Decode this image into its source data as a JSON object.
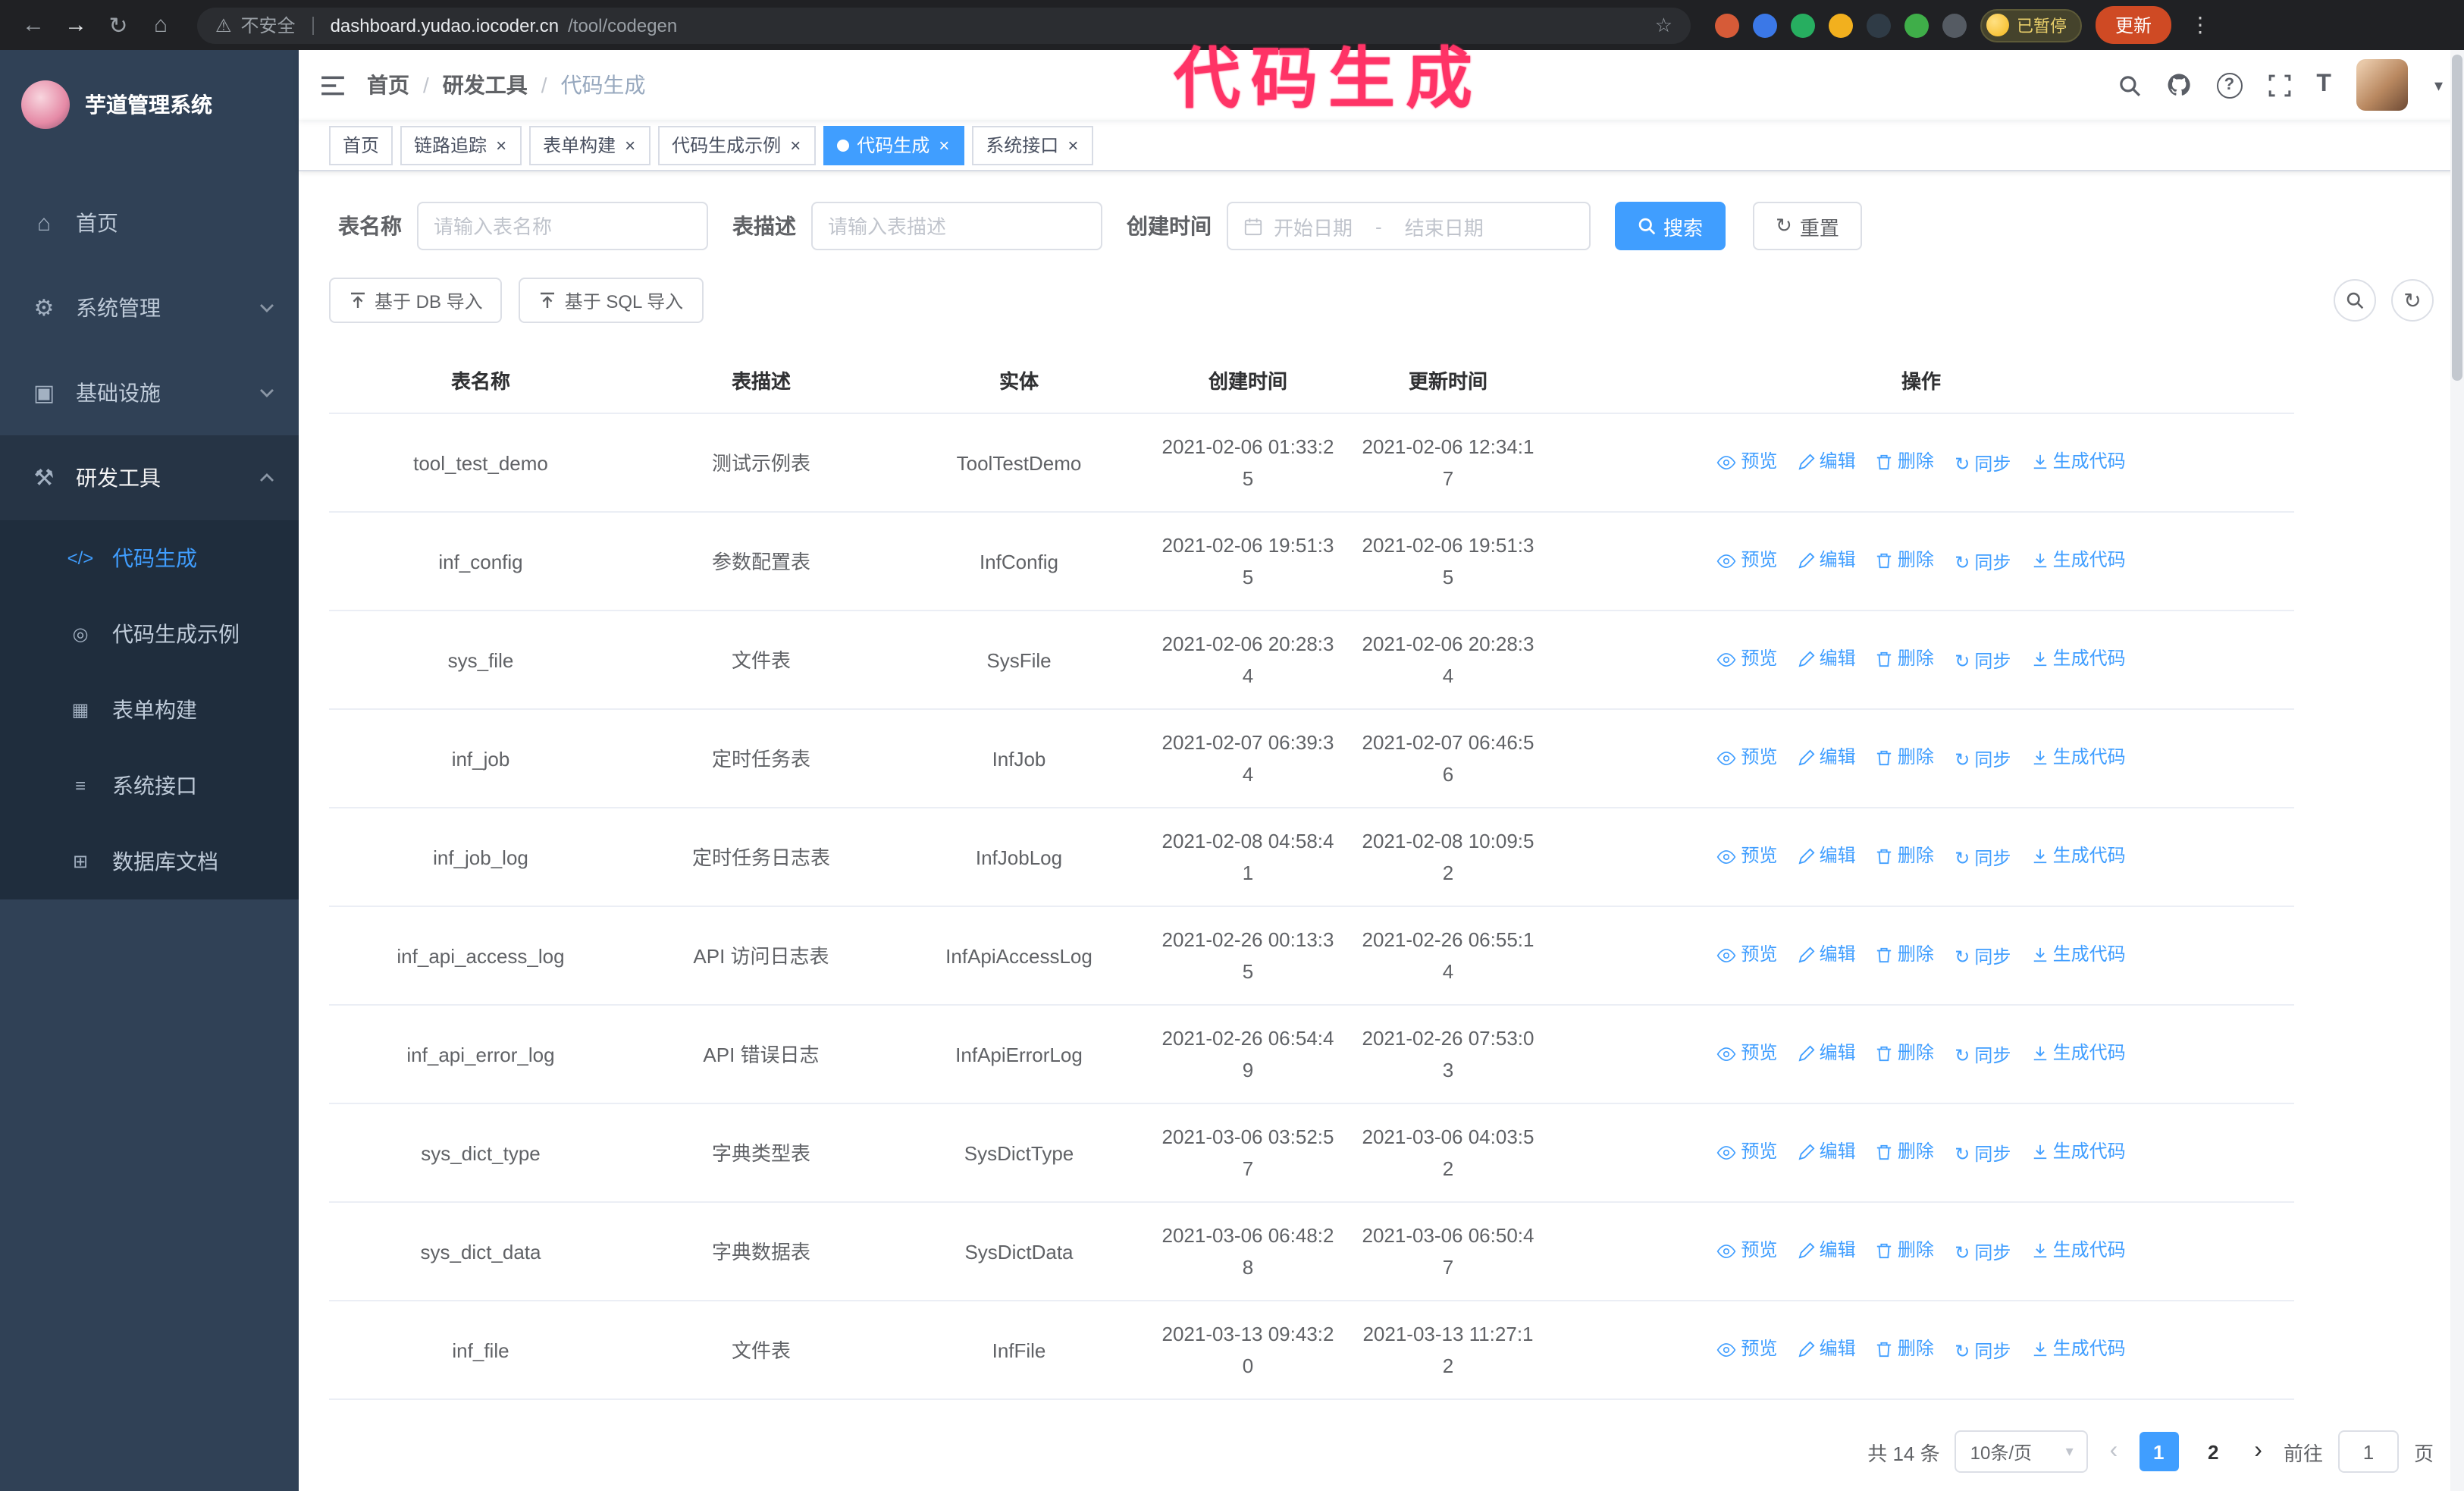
{
  "annotation": {
    "text": "代码生成"
  },
  "colors": {
    "primary": "#409eff",
    "sidebar": "#304156",
    "submenu": "#1f2d3d",
    "annotation": "#ff3366",
    "update_button": "#cf4a24"
  },
  "browser": {
    "security_label": "不安全",
    "url_domain": "dashboard.yudao.iocoder.cn",
    "url_path": "/tool/codegen",
    "paused_badge": "已暂停",
    "update_button": "更新"
  },
  "icons": {
    "back": "←",
    "forward": "→",
    "reload": "↻",
    "home": "⌂",
    "warning": "⚠",
    "star": "☆",
    "kebab": "⋮",
    "close": "×",
    "caret_down": "▾",
    "chevron_prev": "‹",
    "chevron_next": "›",
    "question": "?",
    "font_size": "T",
    "refresh": "↻",
    "sync": "↻",
    "menu_home": "⌂",
    "menu_system": "⚙",
    "menu_infra": "▣",
    "menu_devtools": "⚒",
    "submenu_codegen": "</>",
    "submenu_example": "◎",
    "submenu_form": "▦",
    "submenu_api": "≡",
    "submenu_dbdoc": "⊞"
  },
  "sidebar": {
    "app_title": "芋道管理系统",
    "items": [
      {
        "label": "首页"
      },
      {
        "label": "系统管理"
      },
      {
        "label": "基础设施"
      },
      {
        "label": "研发工具"
      }
    ],
    "submenu": [
      {
        "label": "代码生成"
      },
      {
        "label": "代码生成示例"
      },
      {
        "label": "表单构建"
      },
      {
        "label": "系统接口"
      },
      {
        "label": "数据库文档"
      }
    ]
  },
  "breadcrumb": [
    "首页",
    "研发工具",
    "代码生成"
  ],
  "tabs": [
    {
      "label": "首页"
    },
    {
      "label": "链路追踪"
    },
    {
      "label": "表单构建"
    },
    {
      "label": "代码生成示例"
    },
    {
      "label": "代码生成"
    },
    {
      "label": "系统接口"
    }
  ],
  "filters": {
    "table_name_label": "表名称",
    "table_name_placeholder": "请输入表名称",
    "table_desc_label": "表描述",
    "table_desc_placeholder": "请输入表描述",
    "create_time_label": "创建时间",
    "date_start_placeholder": "开始日期",
    "date_separator": "-",
    "date_end_placeholder": "结束日期",
    "search_button": "搜索",
    "reset_button": "重置"
  },
  "toolbar": {
    "import_db_button": "基于 DB 导入",
    "import_sql_button": "基于 SQL 导入"
  },
  "table": {
    "columns": [
      "表名称",
      "表描述",
      "实体",
      "创建时间",
      "更新时间",
      "操作"
    ],
    "actions": [
      "预览",
      "编辑",
      "删除",
      "同步",
      "生成代码"
    ],
    "rows": [
      {
        "name": "tool_test_demo",
        "desc": "测试示例表",
        "entity": "ToolTestDemo",
        "created": "2021-02-06 01:33:25",
        "updated": "2021-02-06 12:34:17"
      },
      {
        "name": "inf_config",
        "desc": "参数配置表",
        "entity": "InfConfig",
        "created": "2021-02-06 19:51:35",
        "updated": "2021-02-06 19:51:35"
      },
      {
        "name": "sys_file",
        "desc": "文件表",
        "entity": "SysFile",
        "created": "2021-02-06 20:28:34",
        "updated": "2021-02-06 20:28:34"
      },
      {
        "name": "inf_job",
        "desc": "定时任务表",
        "entity": "InfJob",
        "created": "2021-02-07 06:39:34",
        "updated": "2021-02-07 06:46:56"
      },
      {
        "name": "inf_job_log",
        "desc": "定时任务日志表",
        "entity": "InfJobLog",
        "created": "2021-02-08 04:58:41",
        "updated": "2021-02-08 10:09:52"
      },
      {
        "name": "inf_api_access_log",
        "desc": "API 访问日志表",
        "entity": "InfApiAccessLog",
        "created": "2021-02-26 00:13:35",
        "updated": "2021-02-26 06:55:14"
      },
      {
        "name": "inf_api_error_log",
        "desc": "API 错误日志",
        "entity": "InfApiErrorLog",
        "created": "2021-02-26 06:54:49",
        "updated": "2021-02-26 07:53:03"
      },
      {
        "name": "sys_dict_type",
        "desc": "字典类型表",
        "entity": "SysDictType",
        "created": "2021-03-06 03:52:57",
        "updated": "2021-03-06 04:03:52"
      },
      {
        "name": "sys_dict_data",
        "desc": "字典数据表",
        "entity": "SysDictData",
        "created": "2021-03-06 06:48:28",
        "updated": "2021-03-06 06:50:47"
      },
      {
        "name": "inf_file",
        "desc": "文件表",
        "entity": "InfFile",
        "created": "2021-03-13 09:43:20",
        "updated": "2021-03-13 11:27:12"
      }
    ]
  },
  "pagination": {
    "total": "共 14 条",
    "page_size": "10条/页",
    "pages": [
      "1",
      "2"
    ],
    "goto_label": "前往",
    "goto_value": "1",
    "goto_suffix": "页"
  }
}
